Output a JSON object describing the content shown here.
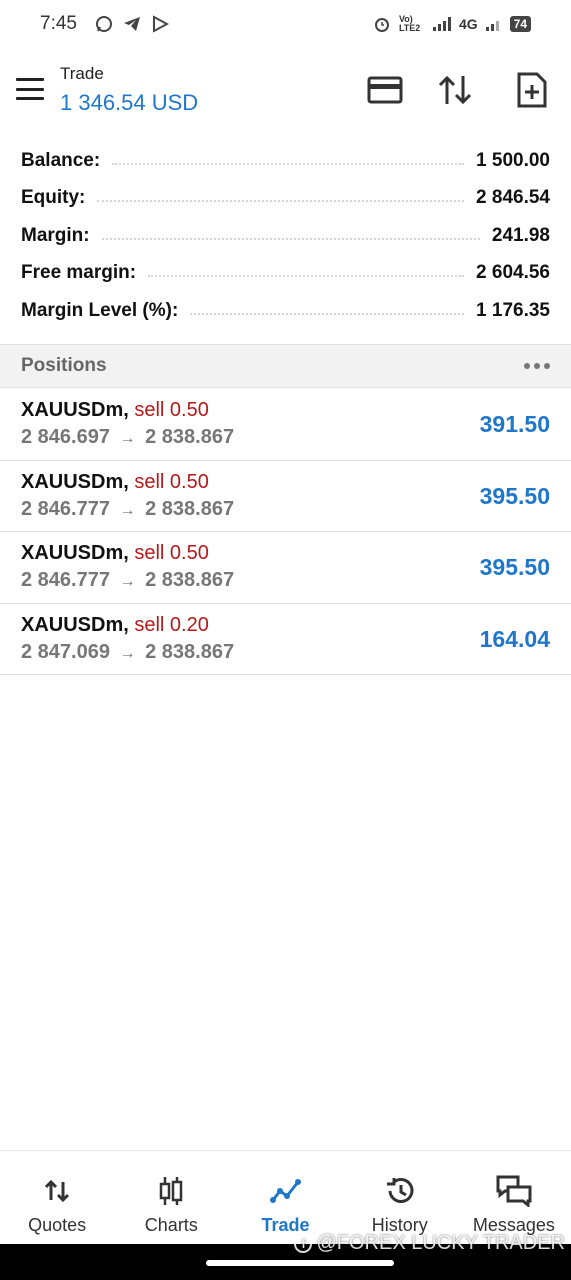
{
  "status_bar": {
    "time": "7:45",
    "network_label": "4G",
    "volte_label": "Vo) LTE2",
    "battery": "74"
  },
  "header": {
    "title": "Trade",
    "balance": "1 346.54 USD"
  },
  "summary": [
    {
      "label": "Balance:",
      "value": "1 500.00"
    },
    {
      "label": "Equity:",
      "value": "2 846.54"
    },
    {
      "label": "Margin:",
      "value": "241.98"
    },
    {
      "label": "Free margin:",
      "value": "2 604.56"
    },
    {
      "label": "Margin Level (%):",
      "value": "1 176.35"
    }
  ],
  "positions": {
    "title": "Positions",
    "items": [
      {
        "symbol": "XAUUSDm,",
        "side": "sell 0.50",
        "open": "2 846.697",
        "arrow": "→",
        "current": "2 838.867",
        "profit": "391.50"
      },
      {
        "symbol": "XAUUSDm,",
        "side": "sell 0.50",
        "open": "2 846.777",
        "arrow": "→",
        "current": "2 838.867",
        "profit": "395.50"
      },
      {
        "symbol": "XAUUSDm,",
        "side": "sell 0.50",
        "open": "2 846.777",
        "arrow": "→",
        "current": "2 838.867",
        "profit": "395.50"
      },
      {
        "symbol": "XAUUSDm,",
        "side": "sell 0.20",
        "open": "2 847.069",
        "arrow": "→",
        "current": "2 838.867",
        "profit": "164.04"
      }
    ]
  },
  "nav": {
    "items": [
      {
        "label": "Quotes",
        "icon": "quotes-icon"
      },
      {
        "label": "Charts",
        "icon": "charts-icon"
      },
      {
        "label": "Trade",
        "icon": "trade-icon",
        "active": true
      },
      {
        "label": "History",
        "icon": "history-icon"
      },
      {
        "label": "Messages",
        "icon": "messages-icon"
      }
    ]
  },
  "watermark": "@FOREX LUCKY TRADER",
  "colors": {
    "accent": "#1f77c9",
    "sell": "#b41a1a",
    "muted": "#777777"
  }
}
